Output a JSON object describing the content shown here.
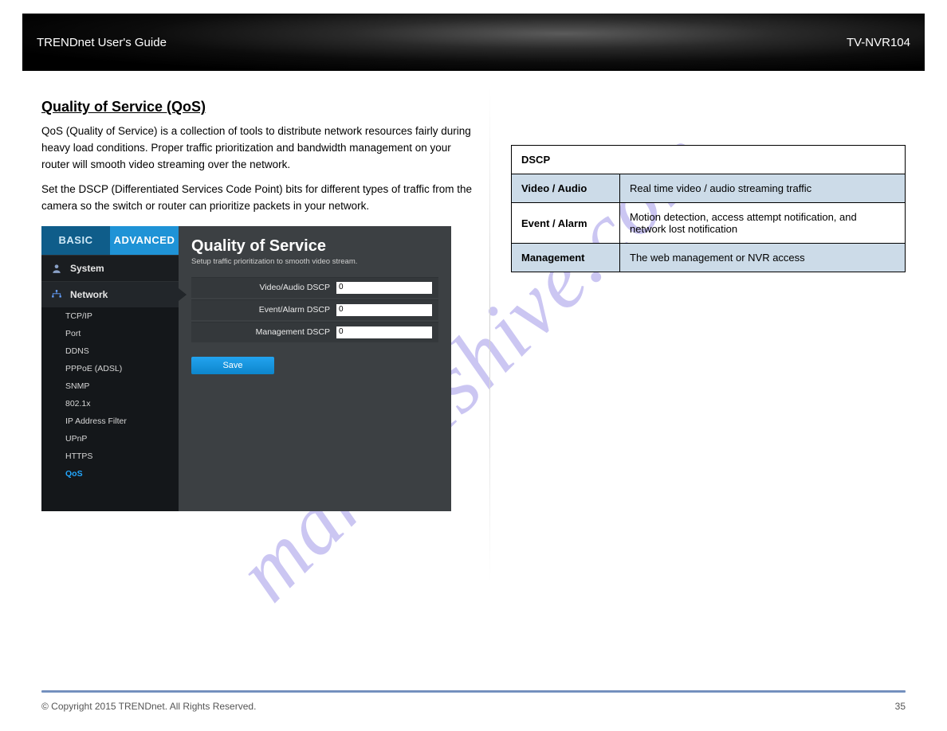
{
  "banner": {
    "left": "TRENDnet User's Guide",
    "right": "TV-NVR104"
  },
  "watermark": "manualshive.com",
  "heading": "Quality of Service (QoS)",
  "para1": "QoS (Quality of Service) is a collection of tools to distribute network resources fairly during heavy load conditions. Proper traffic prioritization and bandwidth management on your router will smooth video streaming over the network.",
  "para2": "Set the DSCP (Differentiated Services Code Point) bits for different types of traffic from the camera so the switch or router can prioritize packets in your network.",
  "shot": {
    "tabs": {
      "basic": "BASIC",
      "advanced": "ADVANCED"
    },
    "groups": {
      "system": "System",
      "network": "Network"
    },
    "subitems": [
      "TCP/IP",
      "Port",
      "DDNS",
      "PPPoE (ADSL)",
      "SNMP",
      "802.1x",
      "IP Address Filter",
      "UPnP",
      "HTTPS",
      "QoS"
    ],
    "active_subitem": "QoS",
    "title": "Quality of Service",
    "subtitle": "Setup traffic prioritization to smooth video stream.",
    "fields": [
      {
        "label": "Video/Audio DSCP",
        "value": "0"
      },
      {
        "label": "Event/Alarm DSCP",
        "value": "0"
      },
      {
        "label": "Management DSCP",
        "value": "0"
      }
    ],
    "save": "Save"
  },
  "table": {
    "header": "DSCP",
    "rows": [
      {
        "label": "Video / Audio",
        "value": "Real time video / audio streaming traffic"
      },
      {
        "label": "Event / Alarm",
        "value": "Motion detection, access attempt notification, and network lost notification"
      },
      {
        "label": "Management",
        "value": "The web management or NVR access"
      }
    ]
  },
  "footer": {
    "copyright": "© Copyright 2015 TRENDnet. All Rights Reserved.",
    "page": "35"
  }
}
